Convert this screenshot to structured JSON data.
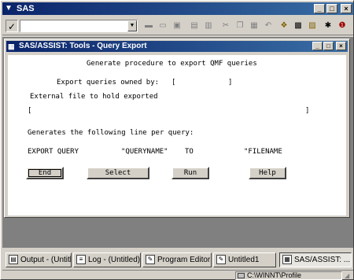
{
  "app": {
    "title": "SAS",
    "window_buttons": [
      "_",
      "□",
      "×"
    ]
  },
  "toolbar": {
    "command_value": "",
    "check_glyph": "✓",
    "dropdown_glyph": "▼",
    "icons": [
      "new-icon",
      "open-icon",
      "save-icon",
      "print-icon",
      "print-preview-icon",
      "cut-icon",
      "copy-icon",
      "paste-icon",
      "undo-icon",
      "explorer-icon",
      "results-icon",
      "library-icon",
      "run-icon",
      "help-icon"
    ]
  },
  "child_window": {
    "title": "SAS/ASSIST: Tools - Query Export",
    "window_buttons": [
      "_",
      "□",
      "×"
    ]
  },
  "form": {
    "heading": "Generate procedure to export QMF queries",
    "owned_by_label": "Export queries owned by:",
    "bracket_open": "[",
    "bracket_close": "]",
    "owned_by_value": "",
    "external_file_label": "External file to hold exported",
    "external_file_value": "",
    "generates_label": "Generates the following line per query:",
    "line": {
      "export_query": "EXPORT QUERY",
      "queryname": "\"QUERYNAME\"",
      "to": "TO",
      "filename": "\"FILENAME"
    },
    "buttons": {
      "end": "End",
      "select": "Select",
      "run": "Run",
      "help": "Help"
    }
  },
  "taskbar": {
    "items": [
      {
        "label": "Output - (Untitled)",
        "icon": "output-icon"
      },
      {
        "label": "Log - (Untitled)",
        "icon": "log-icon"
      },
      {
        "label": "Program Editor - (U...",
        "icon": "program-editor-icon"
      },
      {
        "label": "Untitled1",
        "icon": "untitled-icon"
      },
      {
        "label": "SAS/ASSIST: ...",
        "icon": "sas-assist-icon"
      }
    ]
  },
  "status": {
    "path": "C:\\WINNT\\Profile"
  }
}
